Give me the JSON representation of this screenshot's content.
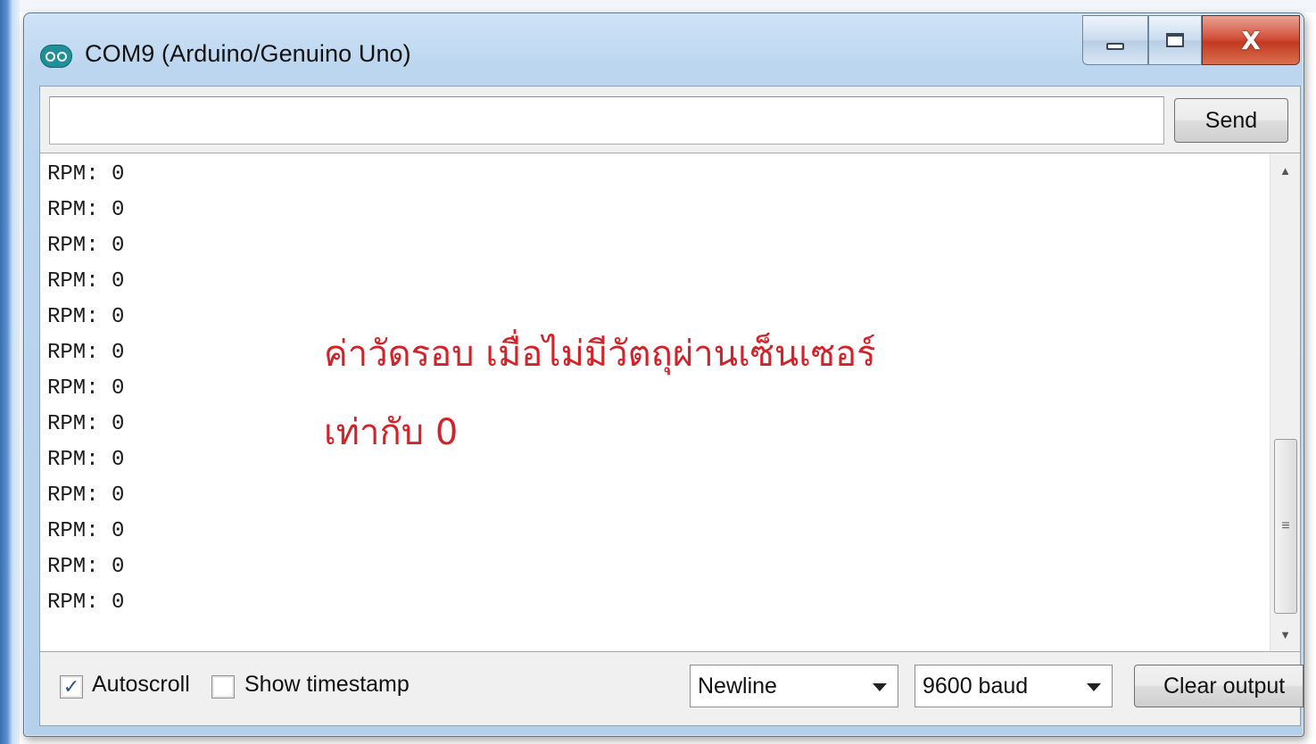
{
  "window": {
    "title": "COM9 (Arduino/Genuino Uno)",
    "icon": "arduino-infinity-icon",
    "caption_buttons": [
      "minimize-icon",
      "maximize-icon",
      "close-icon"
    ],
    "close_glyph": "X"
  },
  "send_bar": {
    "input_value": "",
    "send_label": "Send"
  },
  "output": {
    "lines": [
      "RPM: 0",
      "RPM: 0",
      "RPM: 0",
      "RPM: 0",
      "RPM: 0",
      "RPM: 0",
      "RPM: 0",
      "RPM: 0",
      "RPM: 0",
      "RPM: 0",
      "RPM: 0",
      "RPM: 0",
      "RPM: 0"
    ],
    "annotation_line1": "ค่าวัดรอบ เมื่อไม่มีวัตถุผ่านเซ็นเซอร์",
    "annotation_line2": "เท่ากับ 0",
    "annotation_color": "#d2232a"
  },
  "footer": {
    "autoscroll_label": "Autoscroll",
    "autoscroll_checked": true,
    "timestamp_label": "Show timestamp",
    "timestamp_checked": false,
    "line_ending": "Newline",
    "baud_rate": "9600 baud",
    "clear_label": "Clear output"
  }
}
